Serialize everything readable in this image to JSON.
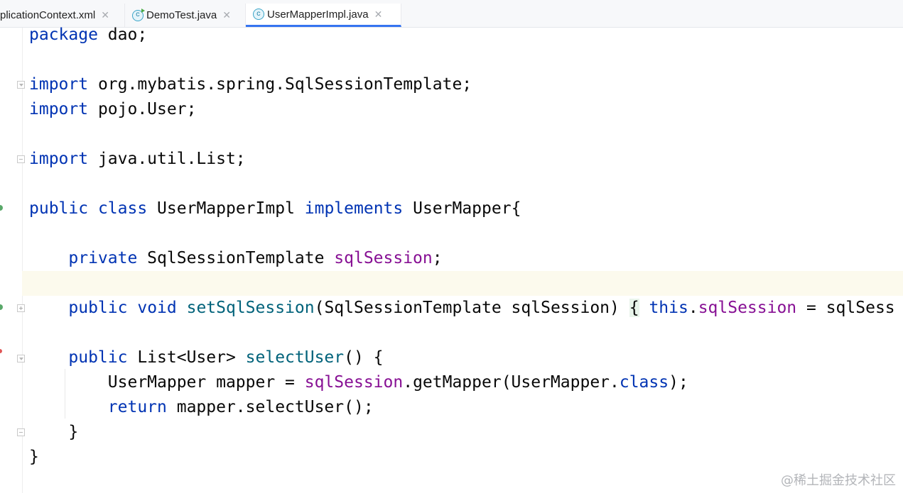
{
  "tabs": [
    {
      "label": "plicationContext.xml",
      "close": "✕",
      "icon": "xml-file-icon",
      "active": false
    },
    {
      "label": "DemoTest.java",
      "close": "✕",
      "icon": "java-test-class-icon",
      "active": false
    },
    {
      "label": "UserMapperImpl.java",
      "close": "✕",
      "icon": "java-class-icon",
      "active": true
    }
  ],
  "file_icon_glyph": "c",
  "code_lines": [
    [
      {
        "t": "package",
        "c": "kw"
      },
      {
        "t": " dao;"
      }
    ],
    [],
    [
      {
        "t": "import",
        "c": "kw"
      },
      {
        "t": " org.mybatis.spring.SqlSessionTemplate;"
      }
    ],
    [
      {
        "t": "import",
        "c": "kw"
      },
      {
        "t": " pojo.User;"
      }
    ],
    [],
    [
      {
        "t": "import",
        "c": "kw"
      },
      {
        "t": " java.util.List;"
      }
    ],
    [],
    [
      {
        "t": "public",
        "c": "kw"
      },
      {
        "t": " "
      },
      {
        "t": "class",
        "c": "kw"
      },
      {
        "t": " UserMapperImpl "
      },
      {
        "t": "implements",
        "c": "kw"
      },
      {
        "t": " UserMapper{"
      }
    ],
    [],
    [
      {
        "t": "    "
      },
      {
        "t": "private",
        "c": "kw"
      },
      {
        "t": " SqlSessionTemplate "
      },
      {
        "t": "sqlSession",
        "c": "fld"
      },
      {
        "t": ";"
      }
    ],
    [],
    [
      {
        "t": "    "
      },
      {
        "t": "public",
        "c": "kw"
      },
      {
        "t": " "
      },
      {
        "t": "void",
        "c": "kw"
      },
      {
        "t": " "
      },
      {
        "t": "setSqlSession",
        "c": "fn"
      },
      {
        "t": "(SqlSessionTemplate sqlSession) "
      },
      {
        "t": "{",
        "c": "brace-hl"
      },
      {
        "t": " "
      },
      {
        "t": "this",
        "c": "kw"
      },
      {
        "t": "."
      },
      {
        "t": "sqlSession",
        "c": "fld"
      },
      {
        "t": " = sqlSess"
      }
    ],
    [],
    [
      {
        "t": "    "
      },
      {
        "t": "public",
        "c": "kw"
      },
      {
        "t": " List<User> "
      },
      {
        "t": "selectUser",
        "c": "fn"
      },
      {
        "t": "() {"
      }
    ],
    [
      {
        "t": "        UserMapper mapper = "
      },
      {
        "t": "sqlSession",
        "c": "fld"
      },
      {
        "t": ".getMapper(UserMapper."
      },
      {
        "t": "class",
        "c": "kw"
      },
      {
        "t": ");"
      }
    ],
    [
      {
        "t": "        "
      },
      {
        "t": "return",
        "c": "kw"
      },
      {
        "t": " mapper.selectUser();"
      }
    ],
    [
      {
        "t": "    }"
      }
    ],
    [
      {
        "t": "}"
      }
    ]
  ],
  "caret_line_index": 10,
  "colors": {
    "keyword": "#0033b3",
    "field": "#871094",
    "method": "#00627a",
    "tab_underline": "#3574f0",
    "caret_line": "#fcfaed"
  },
  "watermark": "@稀土掘金技术社区"
}
